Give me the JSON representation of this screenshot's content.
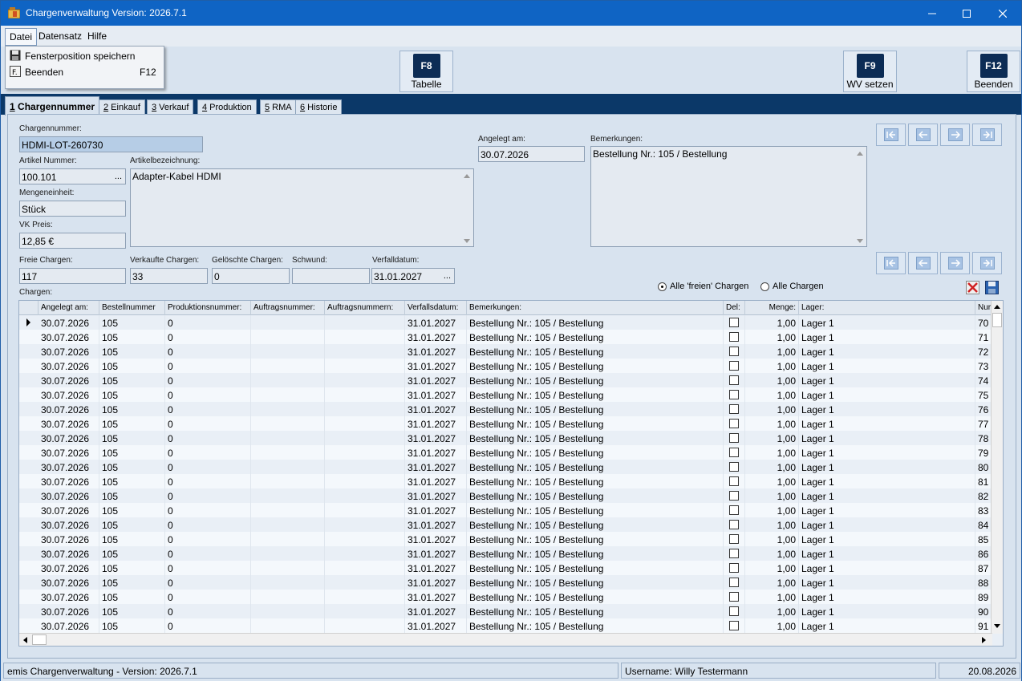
{
  "window": {
    "title": "Chargenverwaltung Version: 2026.7.1",
    "icon": "folder-app-icon"
  },
  "menu": {
    "items": [
      "Datei",
      "Datensatz",
      "Hilfe"
    ],
    "dropdown": [
      {
        "label": "Fensterposition speichern",
        "shortcut": "",
        "icon": "floppy-disk-icon"
      },
      {
        "label": "Beenden",
        "shortcut": "F12",
        "icon": "exit-icon"
      }
    ]
  },
  "toolbar": {
    "buttons": [
      {
        "key": "F8",
        "caption": "Tabelle"
      },
      {
        "key": "F9",
        "caption": "WV setzen"
      },
      {
        "key": "F12",
        "caption": "Beenden"
      }
    ]
  },
  "tabs": [
    {
      "num": "1",
      "label": " Chargennummer"
    },
    {
      "num": "2",
      "label": " Einkauf"
    },
    {
      "num": "3",
      "label": " Verkauf"
    },
    {
      "num": "4",
      "label": " Produktion"
    },
    {
      "num": "5",
      "label": " RMA"
    },
    {
      "num": "6",
      "label": " Historie"
    }
  ],
  "form": {
    "chargennummer_label": "Chargennummer:",
    "chargennummer": "HDMI-LOT-260730",
    "artikelnummer_label": "Artikel Nummer:",
    "artikelnummer": "100.101",
    "artikelbezeichnung_label": "Artikelbezeichnung:",
    "artikelbezeichnung": "Adapter-Kabel HDMI",
    "mengeneinheit_label": "Mengeneinheit:",
    "mengeneinheit": "Stück",
    "vkpreis_label": "VK Preis:",
    "vkpreis": "12,85 €",
    "angelegt_label": "Angelegt am:",
    "angelegt": "30.07.2026",
    "bemerkungen_label": "Bemerkungen:",
    "bemerkungen": "Bestellung Nr.: 105 / Bestellung",
    "freie_label": "Freie Chargen:",
    "freie": "117",
    "verkaufte_label": "Verkaufte Chargen:",
    "verkaufte": "33",
    "geloeschte_label": "Gelöschte Chargen:",
    "geloeschte": "0",
    "schwund_label": "Schwund:",
    "schwund": "",
    "verfall_label": "Verfalldatum:",
    "verfall": "31.01.2027",
    "chargen_label": "Chargen:",
    "ellipsis": "..."
  },
  "filter": {
    "option1": "Alle 'freien' Chargen",
    "option2": "Alle Chargen",
    "selected": 1
  },
  "grid": {
    "columns": [
      "Angelegt am:",
      "Bestellnummer",
      "Produktionsnummer:",
      "Auftragsnummer:",
      "Auftragsnummern:",
      "Verfallsdatum:",
      "Bemerkungen:",
      "Del:",
      "Menge:",
      "Lager:",
      "Nur"
    ],
    "row_template": {
      "angelegt": "30.07.2026",
      "bestellnummer": "105",
      "produktionsnummer": "0",
      "verfall": "31.01.2027",
      "bemerkung": "Bestellung Nr.: 105 / Bestellung",
      "menge": "1,00",
      "lager": "Lager 1"
    },
    "numbers": [
      "70",
      "71",
      "72",
      "73",
      "74",
      "75",
      "76",
      "77",
      "78",
      "79",
      "80",
      "81",
      "82",
      "83",
      "84",
      "85",
      "86",
      "87",
      "88",
      "89",
      "90",
      "91"
    ]
  },
  "status": {
    "app": "emis Chargenverwaltung - Version: 2026.7.1",
    "user": "Username: Willy Testermann",
    "date": "20.08.2026"
  },
  "colors": {
    "titlebar": "#0f64c4",
    "tabstrip": "#0b3868",
    "panel": "#d8e3ef",
    "highlight_field": "#b6cde6"
  }
}
